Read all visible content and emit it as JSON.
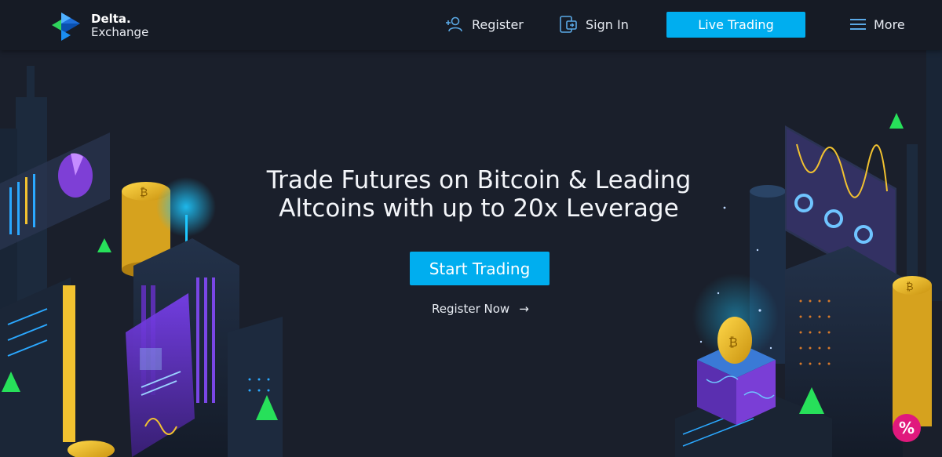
{
  "brand": {
    "name_line1": "Delta.",
    "name_line2": "Exchange"
  },
  "nav": {
    "register_label": "Register",
    "signin_label": "Sign In",
    "live_trading_label": "Live Trading",
    "more_label": "More"
  },
  "hero": {
    "headline_line1": "Trade Futures on Bitcoin & Leading",
    "headline_line2": "Altcoins with up to 20x Leverage",
    "cta_label": "Start Trading",
    "register_link_label": "Register Now",
    "register_link_arrow": "→"
  },
  "promo": {
    "label": "%"
  },
  "icons": {
    "register": "add-user-icon",
    "signin": "device-login-icon",
    "more": "hamburger-menu-icon",
    "arrow": "arrow-right-icon"
  },
  "colors": {
    "background": "#1a1f2b",
    "navbar": "#161b25",
    "accent": "#00aeef",
    "promo": "#e0197d",
    "coin": "#f2c230",
    "pyramid": "#27e05a",
    "neon_purple": "#9b4ff0"
  }
}
